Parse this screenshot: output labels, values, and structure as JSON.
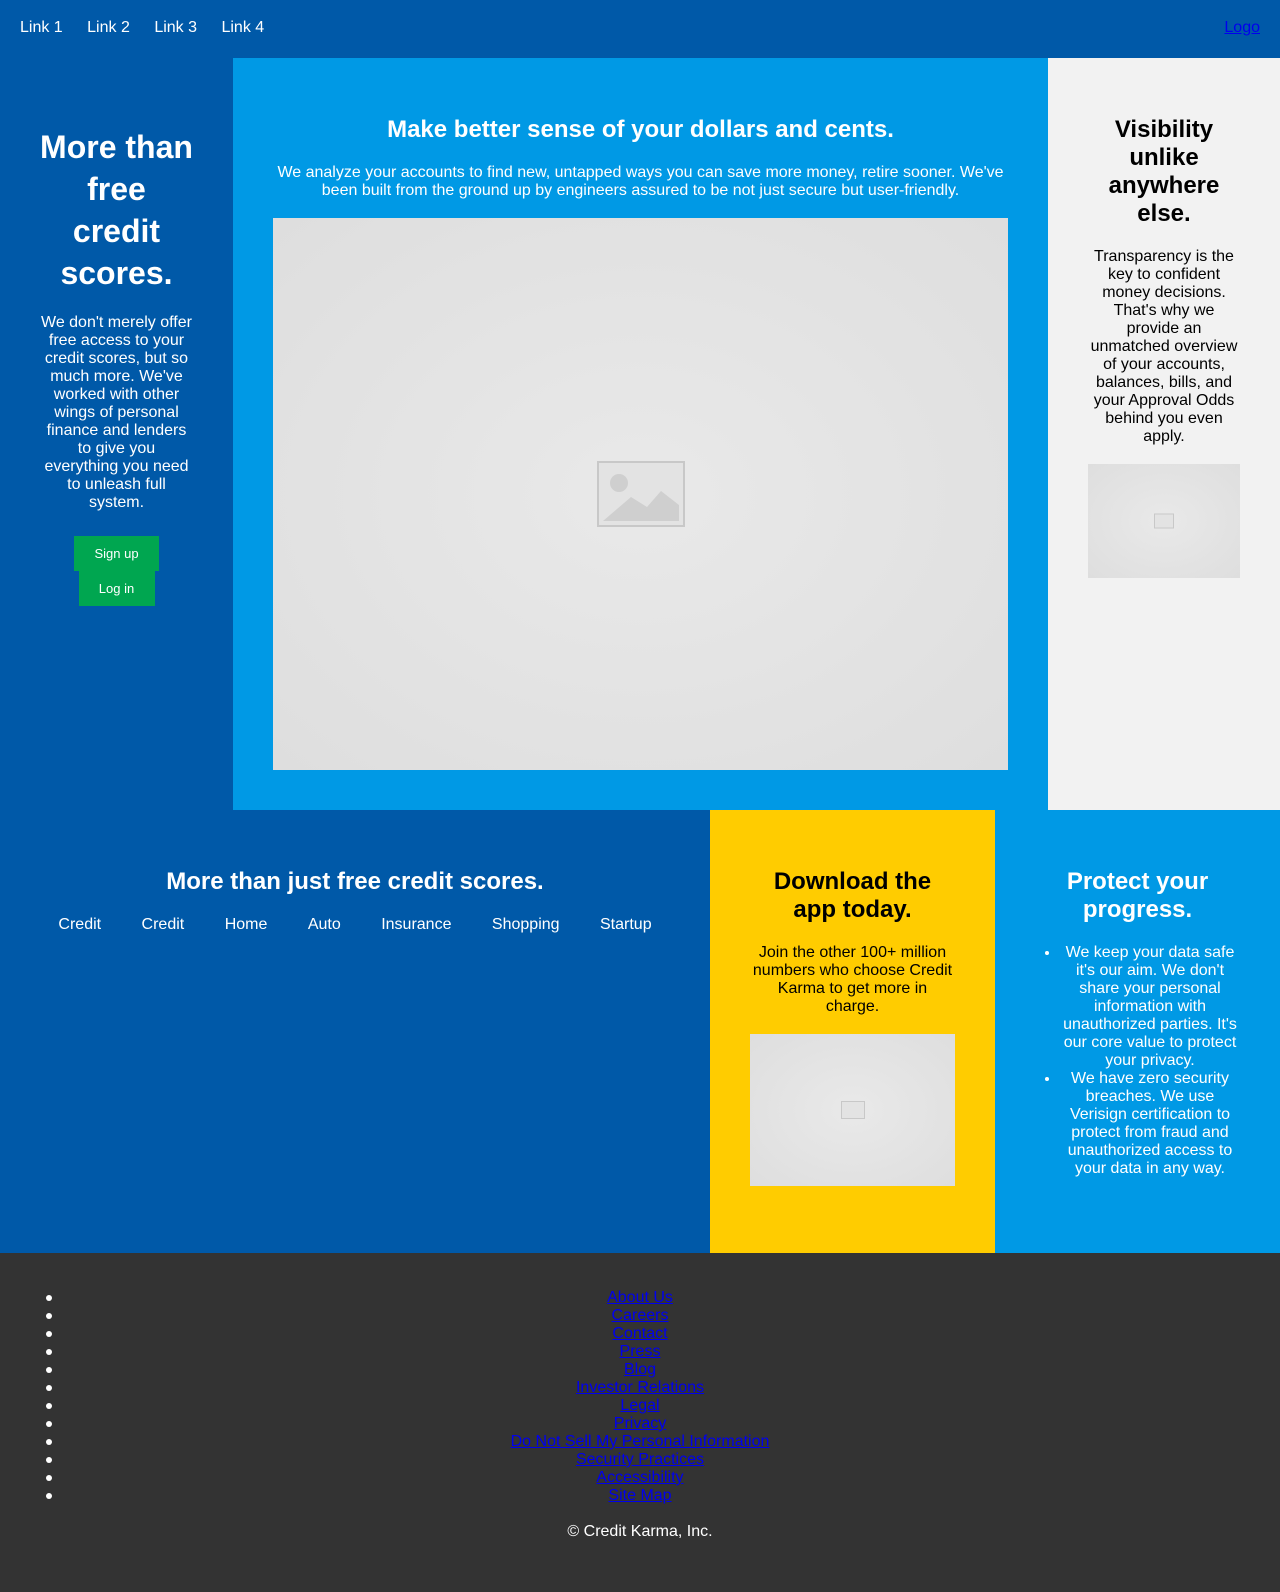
{
  "nav": {
    "links": [
      "Link 1",
      "Link 2",
      "Link 3",
      "Link 4"
    ],
    "logo": "Logo"
  },
  "hero": {
    "title": "More than free credit scores.",
    "body": "We don't merely offer free access to your credit scores, but so much more. We've worked with other wings of personal finance and lenders to give you everything you need to unleash full system.",
    "signup_label": "Sign up",
    "login_label": "Log in"
  },
  "dollars": {
    "title": "Make better sense of your dollars and cents.",
    "body": "We analyze your accounts to find new, untapped ways you can save more money, retire sooner. We've been built from the ground up by engineers assured to be not just secure but user-friendly."
  },
  "visibility": {
    "title": "Visibility unlike anywhere else.",
    "body": "Transparency is the key to confident money decisions. That's why we provide an unmatched overview of your accounts, balances, bills, and your Approval Odds behind you even apply."
  },
  "more": {
    "title": "More than just free credit scores.",
    "categories": [
      "Credit",
      "Credit",
      "Home",
      "Auto",
      "Insurance",
      "Shopping",
      "Startup"
    ]
  },
  "app": {
    "title": "Download the app today.",
    "body": "Join the other 100+ million numbers who choose Credit Karma to get more in charge."
  },
  "protect": {
    "title": "Protect your progress.",
    "points": [
      "We keep your data safe it's our aim. We don't share your personal information with unauthorized parties. It's our core value to protect your privacy.",
      "We have zero security breaches. We use Verisign certification to protect from fraud and unauthorized access to your data in any way."
    ]
  },
  "footer": {
    "links": [
      "About Us",
      "Careers",
      "Contact",
      "Press",
      "Blog",
      "Investor Relations",
      "Legal",
      "Privacy",
      "Do Not Sell My Personal Information",
      "Security Practices",
      "Accessibility",
      "Site Map"
    ],
    "copyright": "© Credit Karma, Inc."
  },
  "colors": {
    "nav_blue": "#0059a8",
    "light_blue": "#0099e5",
    "yellow": "#ffcc00",
    "green_button": "#00a650",
    "footer": "#333333"
  }
}
